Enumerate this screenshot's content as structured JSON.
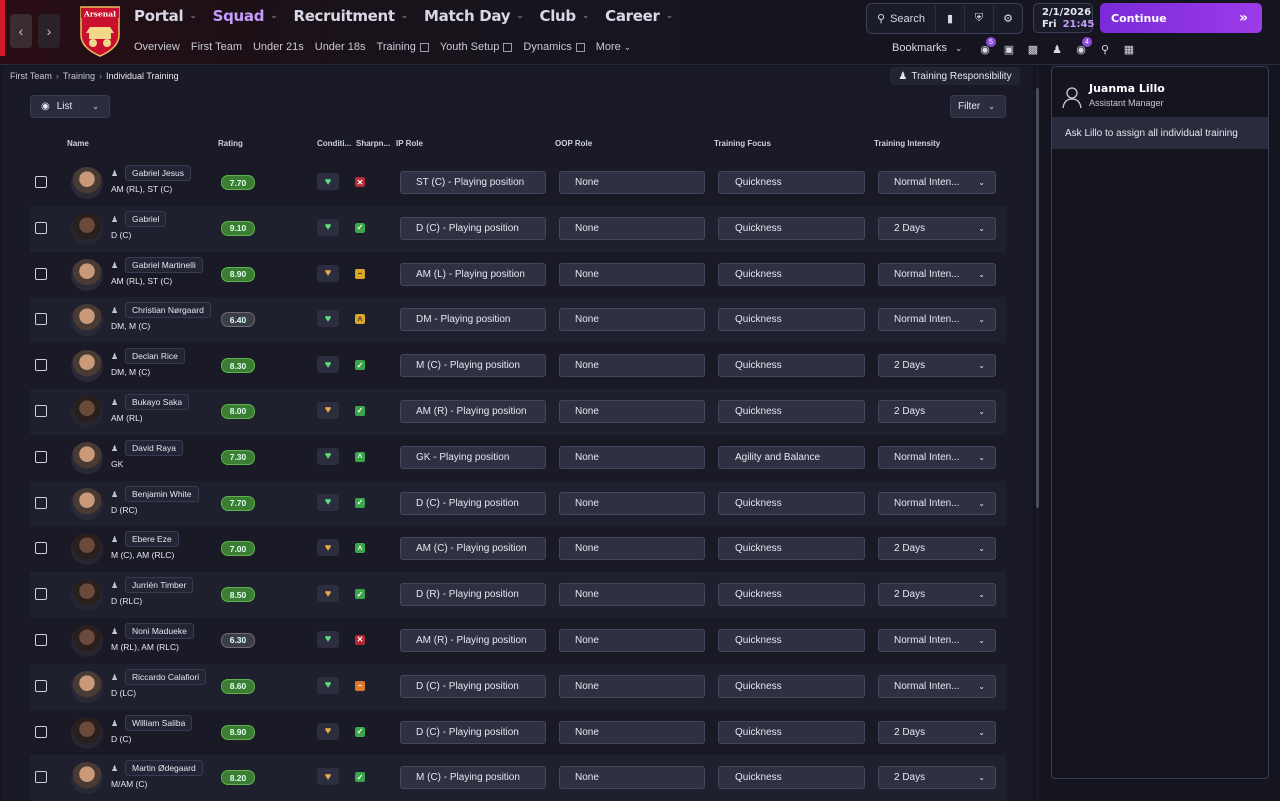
{
  "nav": {
    "menu": [
      {
        "label": "Portal",
        "active": false
      },
      {
        "label": "Squad",
        "active": true
      },
      {
        "label": "Recruitment",
        "active": false
      },
      {
        "label": "Match Day",
        "active": false
      },
      {
        "label": "Club",
        "active": false
      },
      {
        "label": "Career",
        "active": false
      }
    ],
    "submenu": [
      "Overview",
      "First Team",
      "Under 21s",
      "Under 18s",
      "Training",
      "Youth Setup",
      "Dynamics",
      "More"
    ],
    "crest_text": "Arsenal",
    "search_label": "Search",
    "date": "2/1/2026",
    "day": "Fri",
    "time": "21:45",
    "continue_label": "Continue",
    "bookmarks_label": "Bookmarks",
    "badge_a": "5",
    "badge_b": "4"
  },
  "page": {
    "breadcrumb": [
      "First Team",
      "Training",
      "Individual Training"
    ],
    "training_responsibility": "Training Responsibility",
    "view_label": "List",
    "filter_label": "Filter",
    "columns": {
      "name": "Name",
      "rating": "Rating",
      "condition": "Conditi...",
      "sharpness": "Sharpn...",
      "ip_role": "IP Role",
      "oop_role": "OOP Role",
      "focus": "Training Focus",
      "intensity": "Training Intensity"
    }
  },
  "players": [
    {
      "name": "Gabriel Jesus",
      "pos": "AM (RL), ST (C)",
      "rating": "7.70",
      "rating_tone": "green",
      "cond": "green",
      "sharp": "red",
      "ip": "ST (C) - Playing position",
      "oop": "None",
      "focus": "Quickness",
      "intensity": "Normal Inten...",
      "skin": "light"
    },
    {
      "name": "Gabriel",
      "pos": "D (C)",
      "rating": "9.10",
      "rating_tone": "green",
      "cond": "green",
      "sharp": "check",
      "ip": "D (C) - Playing position",
      "oop": "None",
      "focus": "Quickness",
      "intensity": "2 Days",
      "skin": "dark"
    },
    {
      "name": "Gabriel Martinelli",
      "pos": "AM (RL), ST (C)",
      "rating": "8.90",
      "rating_tone": "green",
      "cond": "orange",
      "sharp": "yellow",
      "ip": "AM (L) - Playing position",
      "oop": "None",
      "focus": "Quickness",
      "intensity": "Normal Inten...",
      "skin": "light"
    },
    {
      "name": "Christian Nørgaard",
      "pos": "DM, M (C)",
      "rating": "6.40",
      "rating_tone": "grey",
      "cond": "green",
      "sharp": "up-yellow",
      "ip": "DM - Playing position",
      "oop": "None",
      "focus": "Quickness",
      "intensity": "Normal Inten...",
      "skin": "light"
    },
    {
      "name": "Declan Rice",
      "pos": "DM, M (C)",
      "rating": "8.30",
      "rating_tone": "green",
      "cond": "green",
      "sharp": "check",
      "ip": "M (C) - Playing position",
      "oop": "None",
      "focus": "Quickness",
      "intensity": "2 Days",
      "skin": "light"
    },
    {
      "name": "Bukayo Saka",
      "pos": "AM (RL)",
      "rating": "8.00",
      "rating_tone": "green",
      "cond": "orange",
      "sharp": "check",
      "ip": "AM (R) - Playing position",
      "oop": "None",
      "focus": "Quickness",
      "intensity": "2 Days",
      "skin": "dark"
    },
    {
      "name": "David Raya",
      "pos": "GK",
      "rating": "7.30",
      "rating_tone": "green",
      "cond": "green",
      "sharp": "up",
      "ip": "GK - Playing position",
      "oop": "None",
      "focus": "Agility and Balance",
      "intensity": "Normal Inten...",
      "skin": "light"
    },
    {
      "name": "Benjamin White",
      "pos": "D (RC)",
      "rating": "7.70",
      "rating_tone": "green",
      "cond": "green",
      "sharp": "check",
      "ip": "D (C) - Playing position",
      "oop": "None",
      "focus": "Quickness",
      "intensity": "Normal Inten...",
      "skin": "light"
    },
    {
      "name": "Ebere Eze",
      "pos": "M (C), AM (RLC)",
      "rating": "7.00",
      "rating_tone": "green",
      "cond": "orange",
      "sharp": "up",
      "ip": "AM (C) - Playing position",
      "oop": "None",
      "focus": "Quickness",
      "intensity": "2 Days",
      "skin": "dark"
    },
    {
      "name": "Jurriën Timber",
      "pos": "D (RLC)",
      "rating": "8.50",
      "rating_tone": "green",
      "cond": "orange",
      "sharp": "check",
      "ip": "D (R) - Playing position",
      "oop": "None",
      "focus": "Quickness",
      "intensity": "2 Days",
      "skin": "dark"
    },
    {
      "name": "Noni Madueke",
      "pos": "M (RL), AM (RLC)",
      "rating": "6.30",
      "rating_tone": "grey",
      "cond": "green",
      "sharp": "red",
      "ip": "AM (R) - Playing position",
      "oop": "None",
      "focus": "Quickness",
      "intensity": "Normal Inten...",
      "skin": "dark"
    },
    {
      "name": "Riccardo Calafiori",
      "pos": "D (LC)",
      "rating": "8.60",
      "rating_tone": "green",
      "cond": "green",
      "sharp": "orange",
      "ip": "D (C) - Playing position",
      "oop": "None",
      "focus": "Quickness",
      "intensity": "Normal Inten...",
      "skin": "light"
    },
    {
      "name": "William Saliba",
      "pos": "D (C)",
      "rating": "8.90",
      "rating_tone": "green",
      "cond": "orange",
      "sharp": "check",
      "ip": "D (C) - Playing position",
      "oop": "None",
      "focus": "Quickness",
      "intensity": "2 Days",
      "skin": "dark"
    },
    {
      "name": "Martin Ødegaard",
      "pos": "M/AM (C)",
      "rating": "8.20",
      "rating_tone": "green",
      "cond": "orange",
      "sharp": "check",
      "ip": "M (C) - Playing position",
      "oop": "None",
      "focus": "Quickness",
      "intensity": "2 Days",
      "skin": "light"
    }
  ],
  "staff": {
    "name": "Juanma Lillo",
    "role": "Assistant Manager",
    "action": "Ask Lillo to assign all individual training"
  }
}
